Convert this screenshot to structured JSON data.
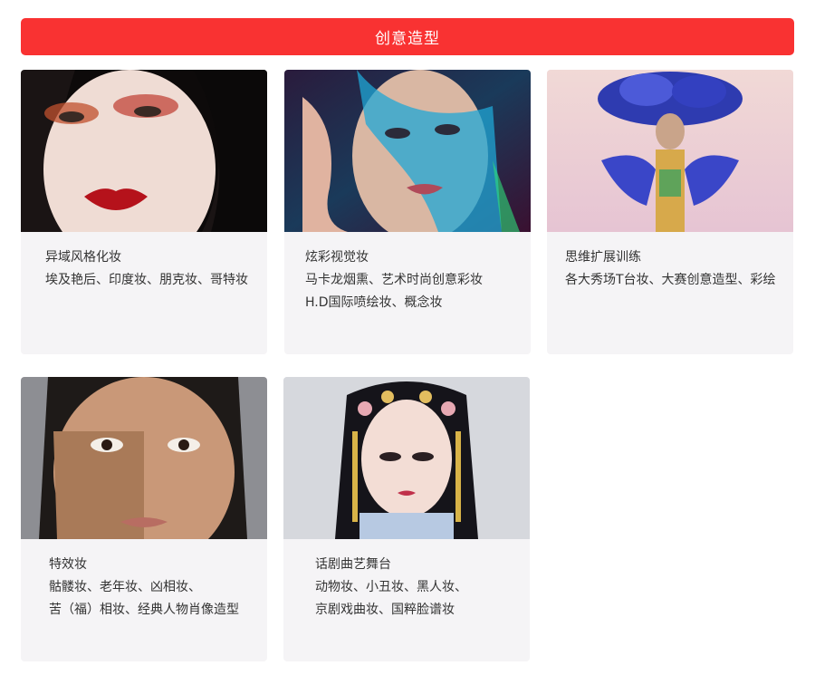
{
  "header": {
    "title": "创意造型"
  },
  "cards": [
    {
      "image_alt": "",
      "title": "异域风格化妆",
      "lines": [
        "埃及艳后、印度妆、朋克妆、哥特妆"
      ]
    },
    {
      "image_alt": "",
      "title": "炫彩视觉妆",
      "lines": [
        "马卡龙烟熏、艺术时尚创意彩妆",
        "H.D国际喷绘妆、概念妆"
      ]
    },
    {
      "image_alt": "",
      "title": "思维扩展训练",
      "lines": [
        "各大秀场T台妆、大赛创意造型、彩绘"
      ]
    },
    {
      "image_alt": "",
      "title": "特效妆",
      "lines": [
        "骷髅妆、老年妆、凶相妆、",
        "苦（福）相妆、经典人物肖像造型"
      ]
    },
    {
      "image_alt": "",
      "title": "话剧曲艺舞台",
      "lines": [
        "动物妆、小丑妆、黑人妆、",
        "京剧戏曲妆、国粹脸谱妆"
      ]
    }
  ],
  "colors": {
    "accent": "#f93232",
    "card_bg": "#f5f4f6"
  }
}
